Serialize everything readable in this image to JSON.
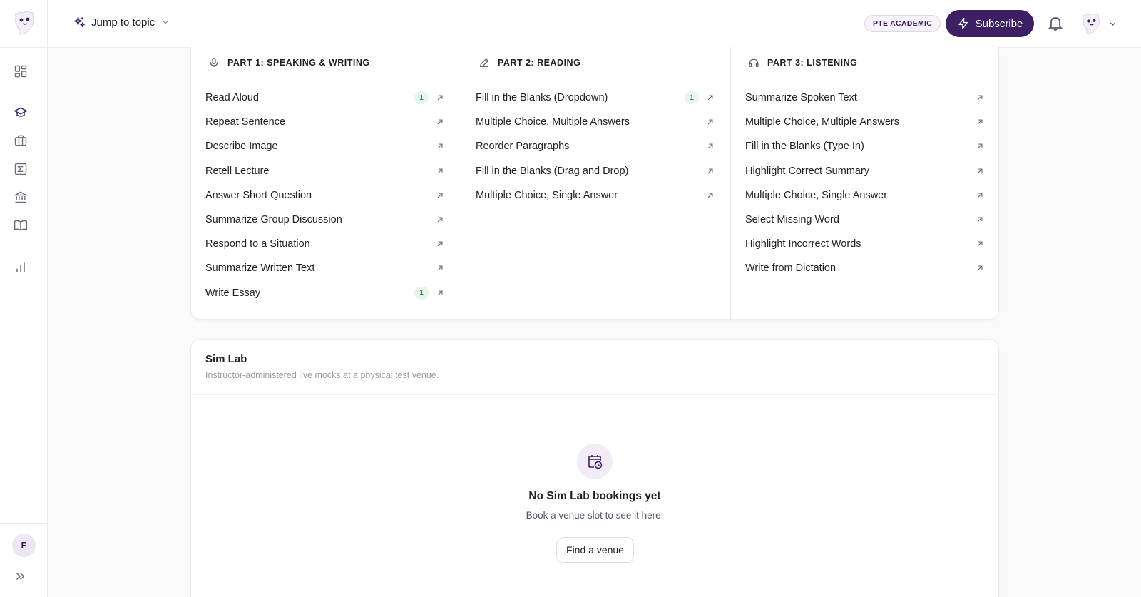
{
  "header": {
    "jump_label": "Jump to topic",
    "exam_badge": "PTE ACADEMIC",
    "subscribe_label": "Subscribe"
  },
  "sidebar": {
    "items": [
      {
        "icon": "dashboard-icon"
      },
      {
        "icon": "graduation-cap-icon",
        "active": true
      },
      {
        "icon": "briefcase-icon"
      },
      {
        "icon": "sigma-icon"
      },
      {
        "icon": "bank-icon"
      },
      {
        "icon": "book-icon"
      },
      {
        "icon": "bar-chart-icon"
      }
    ],
    "user_initial": "F"
  },
  "parts": [
    {
      "title": "PART 1: SPEAKING & WRITING",
      "icon": "microphone-icon",
      "tasks": [
        {
          "label": "Read Aloud",
          "count": "1"
        },
        {
          "label": "Repeat Sentence"
        },
        {
          "label": "Describe Image"
        },
        {
          "label": "Retell Lecture"
        },
        {
          "label": "Answer Short Question"
        },
        {
          "label": "Summarize Group Discussion"
        },
        {
          "label": "Respond to a Situation"
        },
        {
          "label": "Summarize Written Text"
        },
        {
          "label": "Write Essay",
          "count": "1"
        }
      ]
    },
    {
      "title": "PART 2: READING",
      "icon": "pen-icon",
      "tasks": [
        {
          "label": "Fill in the Blanks (Dropdown)",
          "count": "1"
        },
        {
          "label": "Multiple Choice, Multiple Answers"
        },
        {
          "label": "Reorder Paragraphs"
        },
        {
          "label": "Fill in the Blanks (Drag and Drop)"
        },
        {
          "label": "Multiple Choice, Single Answer"
        }
      ]
    },
    {
      "title": "PART 3: LISTENING",
      "icon": "headphones-icon",
      "tasks": [
        {
          "label": "Summarize Spoken Text"
        },
        {
          "label": "Multiple Choice, Multiple Answers"
        },
        {
          "label": "Fill in the Blanks (Type In)"
        },
        {
          "label": "Highlight Correct Summary"
        },
        {
          "label": "Multiple Choice, Single Answer"
        },
        {
          "label": "Select Missing Word"
        },
        {
          "label": "Highlight Incorrect Words"
        },
        {
          "label": "Write from Dictation"
        }
      ]
    }
  ],
  "sim_lab": {
    "title": "Sim Lab",
    "subtitle": "Instructor-administered live mocks at a physical test venue.",
    "empty_title": "No Sim Lab bookings yet",
    "empty_subtitle": "Book a venue slot to see it here.",
    "find_button": "Find a venue"
  },
  "colors": {
    "brand": "#3d1f64",
    "count_bg": "#e7f5ec",
    "count_text": "#1f8a4c"
  }
}
